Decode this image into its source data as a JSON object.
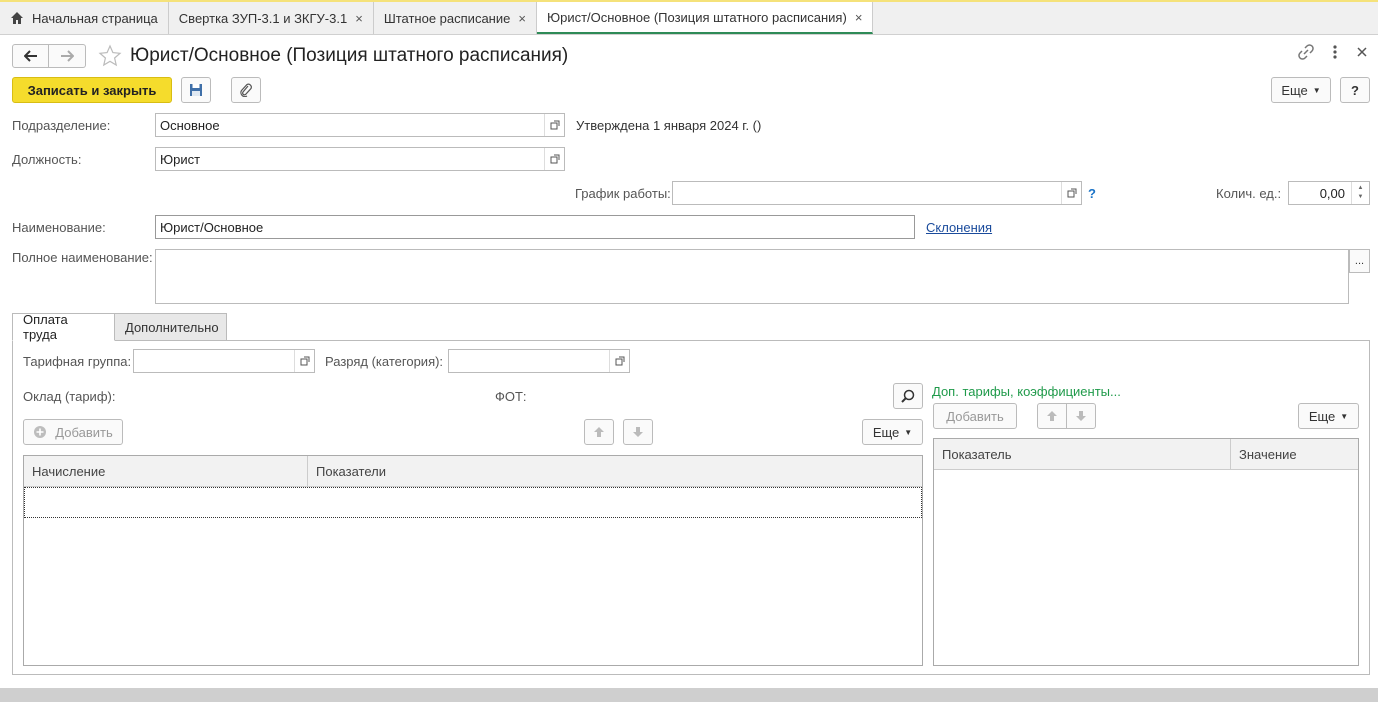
{
  "tabs": [
    {
      "label": "Начальная страница"
    },
    {
      "label": "Свертка ЗУП-3.1 и ЗКГУ-3.1"
    },
    {
      "label": "Штатное расписание"
    },
    {
      "label": "Юрист/Основное (Позиция штатного расписания)"
    }
  ],
  "close_glyph": "×",
  "form": {
    "title": "Юрист/Основное (Позиция штатного расписания)",
    "save_close": "Записать и закрыть",
    "more": "Еще",
    "help": "?"
  },
  "fields": {
    "dept_label": "Подразделение:",
    "dept_value": "Основное",
    "approved": "Утверждена 1 января 2024 г. ()",
    "position_label": "Должность:",
    "position_value": "Юрист",
    "schedule_label": "График работы:",
    "schedule_value": "",
    "qty_label": "Колич. ед.:",
    "qty_value": "0,00",
    "name_label": "Наименование:",
    "name_value": "Юрист/Основное",
    "declension_link": "Склонения",
    "fullname_label": "Полное наименование:",
    "fullname_value": "",
    "ellipsis": "..."
  },
  "page_tabs": [
    {
      "label": "Оплата труда"
    },
    {
      "label": "Дополнительно"
    }
  ],
  "pay": {
    "tariff_group_label": "Тарифная группа:",
    "grade_label": "Разряд (категория):",
    "salary_label": "Оклад (тариф):",
    "fot_label": "ФОТ:",
    "add": "Добавить",
    "more": "Еще",
    "columns": [
      "Начисление",
      "Показатели"
    ],
    "extra_title": "Доп. тарифы, коэффициенты...",
    "extra_add": "Добавить",
    "extra_more": "Еще",
    "extra_columns": [
      "Показатель",
      "Значение"
    ]
  },
  "colors": {
    "accent": "#f5dc2c",
    "green": "#1f9a4a",
    "link": "#1a4b9c"
  }
}
